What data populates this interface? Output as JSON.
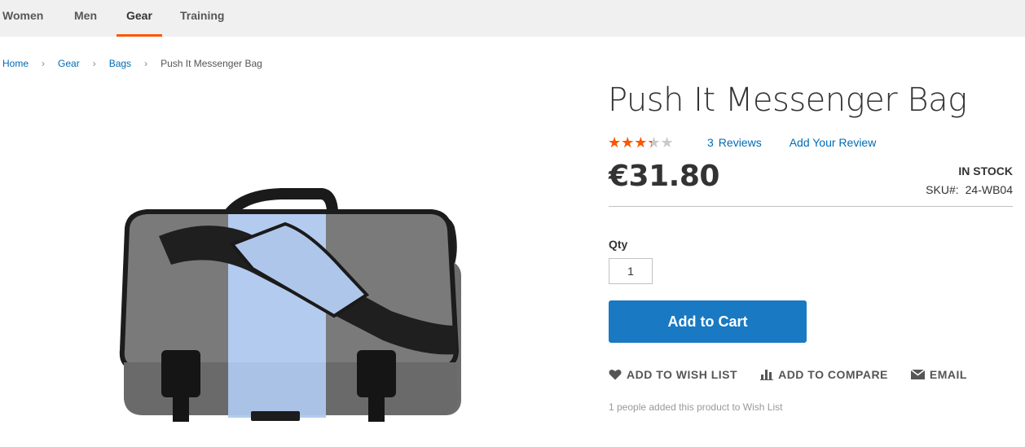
{
  "nav": {
    "items": [
      {
        "label": "Women",
        "active": false
      },
      {
        "label": "Men",
        "active": false
      },
      {
        "label": "Gear",
        "active": true
      },
      {
        "label": "Training",
        "active": false
      }
    ]
  },
  "breadcrumbs": {
    "home": "Home",
    "gear": "Gear",
    "bags": "Bags",
    "current": "Push It Messenger Bag"
  },
  "product": {
    "title": "Push It Messenger Bag",
    "rating_percent": 60,
    "stars_glyph": "★★★★★",
    "reviews_count": "3",
    "reviews_label": "Reviews",
    "add_review": "Add Your Review",
    "price": "€31.80",
    "stock": "In stock",
    "sku_label": "SKU#:",
    "sku": "24-WB04",
    "qty_label": "Qty",
    "qty_value": "1",
    "add_to_cart": "Add to Cart",
    "wishlist": "Add to Wish List",
    "compare": "Add to Compare",
    "email": "Email",
    "wishlist_note": "1 people added this product to Wish List",
    "image_icon": "messenger-bag-image"
  },
  "colors": {
    "accent": "#ff5501",
    "link": "#006bb4",
    "primary_button": "#1979c3"
  }
}
